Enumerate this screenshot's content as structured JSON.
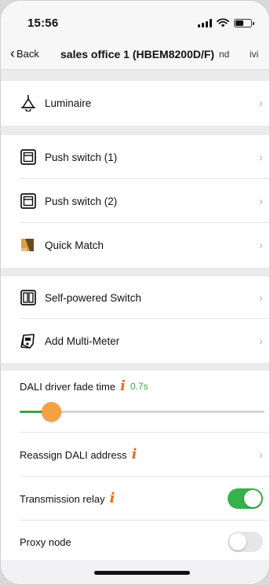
{
  "status_bar": {
    "time": "15:56"
  },
  "nav": {
    "back_label": "Back",
    "title": "sales office 1 (HBEM8200D/F)",
    "right_text_1": "nd",
    "right_text_2": "ivi"
  },
  "devices": [
    {
      "label": "Luminaire",
      "icon": "lamp-icon"
    },
    {
      "label": "Push switch (1)",
      "icon": "switch-icon"
    },
    {
      "label": "Push switch (2)",
      "icon": "switch-icon"
    },
    {
      "label": "Quick Match",
      "icon": "quick-match-icon"
    },
    {
      "label": "Self-powered Switch",
      "icon": "double-switch-icon"
    },
    {
      "label": "Add Multi-Meter",
      "icon": "meter-icon"
    }
  ],
  "settings": {
    "fade_time_label": "DALI driver fade time",
    "fade_time_value": "0.7s",
    "fade_time_fraction": 0.13,
    "reassign_label": "Reassign DALI address",
    "transmission_relay_label": "Transmission relay",
    "transmission_relay_on": true,
    "proxy_node_label": "Proxy node",
    "proxy_node_on": false
  },
  "colors": {
    "accent_green": "#35a545",
    "slider_thumb": "#f5a042",
    "info_orange": "#e2711d"
  }
}
